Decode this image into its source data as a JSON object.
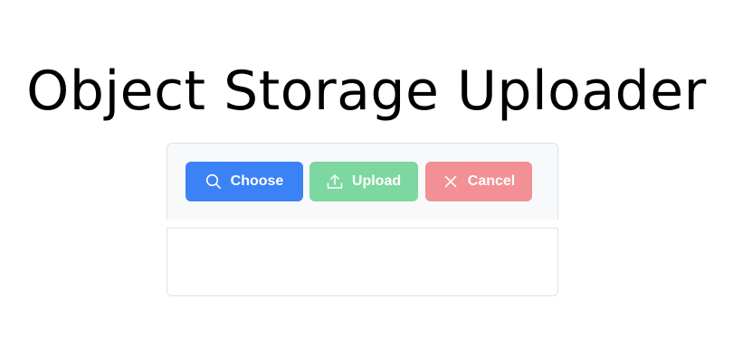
{
  "page": {
    "title": "Object Storage Uploader"
  },
  "uploader": {
    "choose_label": "Choose",
    "upload_label": "Upload",
    "cancel_label": "Cancel",
    "choose_icon": "search-icon",
    "upload_icon": "upload-icon",
    "cancel_icon": "close-icon"
  },
  "colors": {
    "choose": "#3b82f6",
    "upload": "#7dd7a0",
    "cancel": "#f39096",
    "toolbar_bg": "#f8f9fa",
    "border": "#dee2e6"
  }
}
